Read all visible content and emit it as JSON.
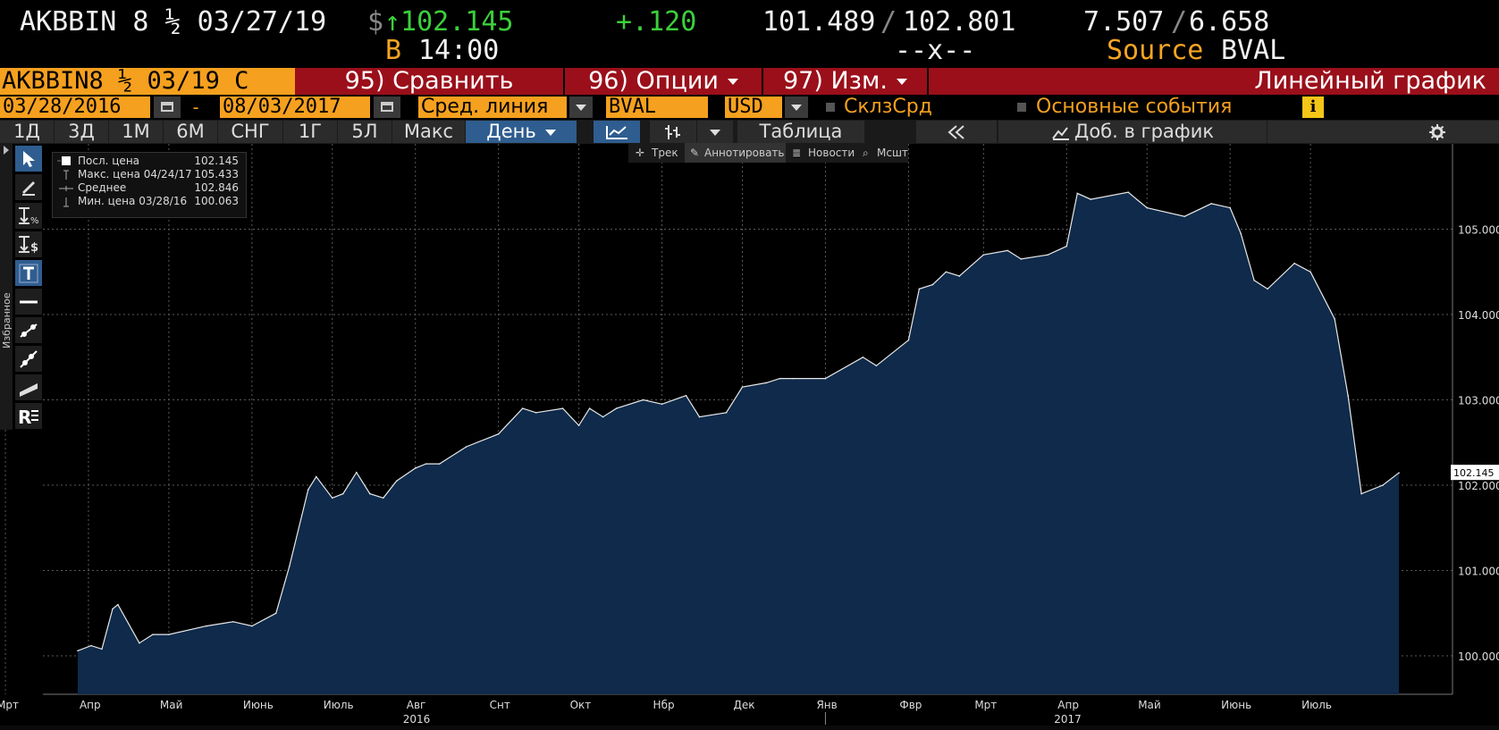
{
  "header": {
    "ticker": "AKBBIN 8 ½ 03/27/19",
    "price_currency": "$",
    "price": "↑102.145",
    "change": "+.120",
    "time_prefix": "В",
    "time": "14:00",
    "bid_ask_left": "101.489",
    "bid_ask_sep": "/",
    "bid_ask_right": "102.801",
    "bid_ask_size": "--x--",
    "yield_left": "7.507",
    "yield_sep": "/",
    "yield_right": "6.658",
    "source_label": "Source",
    "source_value": "BVAL"
  },
  "menubar": {
    "ticker_short": "AKBBIN8 ½ 03/19 C",
    "compare": "95) Сравнить",
    "options": "96) Опции",
    "edit": "97) Изм.",
    "chart_type": "Линейный график"
  },
  "controls": {
    "start_date": "03/28/2016",
    "dash": "-",
    "end_date": "08/03/2017",
    "line_type": "Сред. линия",
    "source": "BVAL",
    "currency": "USD",
    "check1": "СклзСрд",
    "check2": "Основные события",
    "info": "i"
  },
  "tabs": {
    "items": [
      "1Д",
      "3Д",
      "1М",
      "6М",
      "СНГ",
      "1Г",
      "5Л",
      "Макс"
    ],
    "period": "День",
    "table": "Таблица",
    "add_to_chart": "Доб. в график"
  },
  "annotation_bar": {
    "track": "Трек",
    "annotate": "Аннотировать",
    "news": "Новости",
    "zoom": "Мсшт"
  },
  "side_label": "Избранное",
  "legend": {
    "rows": [
      {
        "name": "Посл. цена",
        "value": "102.145"
      },
      {
        "name": "Макс. цена 04/24/17",
        "value": "105.433"
      },
      {
        "name": "Среднее",
        "value": "102.846"
      },
      {
        "name": "Мин. цена 03/28/16",
        "value": "100.063"
      }
    ]
  },
  "colors": {
    "accent_orange": "#f5a01e",
    "menu_red": "#9a0f1a",
    "price_green": "#3ccf3c",
    "area_fill": "#0f2a4a",
    "line": "#e8e8e8",
    "active_tab": "#2f5d8f"
  },
  "chart_data": {
    "type": "area",
    "ylim": [
      99.55,
      106.0
    ],
    "yticks": [
      100.0,
      101.0,
      102.0,
      103.0,
      104.0,
      105.0
    ],
    "ytick_labels": [
      "100.000",
      "101.000",
      "102.000",
      "103.000",
      "104.000",
      "105.000"
    ],
    "last_label": "102.145",
    "xtick_labels": [
      "Мрт",
      "Апр",
      "Май",
      "Июнь",
      "Июль",
      "Авг",
      "Снт",
      "Окт",
      "Нбр",
      "Дек",
      "Янв",
      "Фвр",
      "Мрт",
      "Апр",
      "Май",
      "Июнь",
      "Июль"
    ],
    "xtick_dates": [
      "2016-03-01",
      "2016-04-01",
      "2016-05-01",
      "2016-06-01",
      "2016-07-01",
      "2016-08-01",
      "2016-09-01",
      "2016-10-01",
      "2016-11-01",
      "2016-12-01",
      "2017-01-01",
      "2017-02-01",
      "2017-03-01",
      "2017-04-01",
      "2017-05-01",
      "2017-06-01",
      "2017-07-01"
    ],
    "year_labels": [
      {
        "text": "2016",
        "date": "2016-08-01"
      },
      {
        "text": "2017",
        "date": "2017-04-01"
      }
    ],
    "x": [
      "2016-03-28",
      "2016-04-02",
      "2016-04-06",
      "2016-04-10",
      "2016-04-12",
      "2016-04-20",
      "2016-04-25",
      "2016-05-01",
      "2016-05-15",
      "2016-05-25",
      "2016-06-01",
      "2016-06-10",
      "2016-06-15",
      "2016-06-22",
      "2016-06-25",
      "2016-07-01",
      "2016-07-05",
      "2016-07-10",
      "2016-07-15",
      "2016-07-20",
      "2016-07-25",
      "2016-08-01",
      "2016-08-05",
      "2016-08-10",
      "2016-08-20",
      "2016-09-01",
      "2016-09-10",
      "2016-09-15",
      "2016-09-25",
      "2016-10-01",
      "2016-10-05",
      "2016-10-10",
      "2016-10-15",
      "2016-10-25",
      "2016-11-01",
      "2016-11-10",
      "2016-11-15",
      "2016-11-25",
      "2016-12-01",
      "2016-12-10",
      "2016-12-15",
      "2016-12-20",
      "2017-01-01",
      "2017-01-15",
      "2017-01-20",
      "2017-02-01",
      "2017-02-05",
      "2017-02-10",
      "2017-02-15",
      "2017-02-20",
      "2017-03-01",
      "2017-03-10",
      "2017-03-15",
      "2017-03-25",
      "2017-04-01",
      "2017-04-05",
      "2017-04-10",
      "2017-04-24",
      "2017-05-01",
      "2017-05-15",
      "2017-05-25",
      "2017-06-01",
      "2017-06-05",
      "2017-06-10",
      "2017-06-15",
      "2017-06-25",
      "2017-07-01",
      "2017-07-10",
      "2017-07-15",
      "2017-07-20",
      "2017-07-28",
      "2017-08-03"
    ],
    "values": [
      100.06,
      100.12,
      100.08,
      100.55,
      100.6,
      100.15,
      100.25,
      100.25,
      100.35,
      100.4,
      100.35,
      100.5,
      101.05,
      101.95,
      102.1,
      101.85,
      101.9,
      102.15,
      101.9,
      101.85,
      102.05,
      102.2,
      102.25,
      102.25,
      102.45,
      102.6,
      102.9,
      102.85,
      102.9,
      102.7,
      102.9,
      102.8,
      102.9,
      103.0,
      102.95,
      103.05,
      102.8,
      102.85,
      103.15,
      103.2,
      103.25,
      103.25,
      103.25,
      103.5,
      103.4,
      103.7,
      104.3,
      104.35,
      104.5,
      104.45,
      104.7,
      104.75,
      104.65,
      104.7,
      104.8,
      105.42,
      105.35,
      105.433,
      105.25,
      105.15,
      105.3,
      105.25,
      104.95,
      104.4,
      104.3,
      104.6,
      104.5,
      103.95,
      103.05,
      101.9,
      102.0,
      102.145
    ]
  }
}
